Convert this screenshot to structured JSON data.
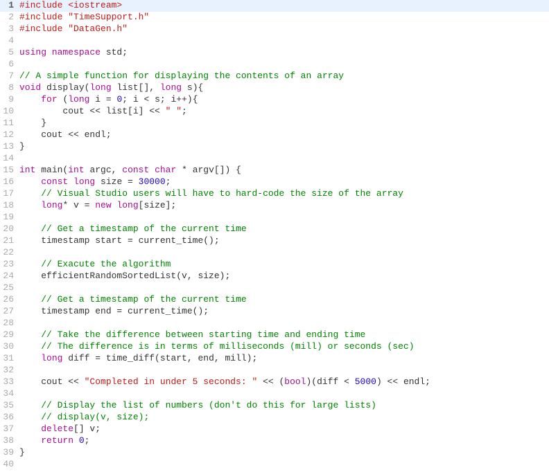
{
  "lines": [
    {
      "n": 1,
      "hl": true,
      "tokens": [
        {
          "t": "#include ",
          "c": "pp-kw"
        },
        {
          "t": "<iostream>",
          "c": "inc-sys"
        }
      ]
    },
    {
      "n": 2,
      "tokens": [
        {
          "t": "#include ",
          "c": "pp-kw"
        },
        {
          "t": "\"TimeSupport.h\"",
          "c": "str"
        }
      ]
    },
    {
      "n": 3,
      "tokens": [
        {
          "t": "#include ",
          "c": "pp-kw"
        },
        {
          "t": "\"DataGen.h\"",
          "c": "str"
        }
      ]
    },
    {
      "n": 4,
      "tokens": []
    },
    {
      "n": 5,
      "tokens": [
        {
          "t": "using namespace ",
          "c": "kw"
        },
        {
          "t": "std;",
          "c": "id"
        }
      ]
    },
    {
      "n": 6,
      "tokens": []
    },
    {
      "n": 7,
      "tokens": [
        {
          "t": "// A simple function for displaying the contents of an array",
          "c": "cmt"
        }
      ]
    },
    {
      "n": 8,
      "tokens": [
        {
          "t": "void ",
          "c": "kw"
        },
        {
          "t": "display(",
          "c": "id"
        },
        {
          "t": "long ",
          "c": "kw"
        },
        {
          "t": "list[], ",
          "c": "id"
        },
        {
          "t": "long ",
          "c": "kw"
        },
        {
          "t": "s){",
          "c": "id"
        }
      ]
    },
    {
      "n": 9,
      "tokens": [
        {
          "t": "    ",
          "c": "id"
        },
        {
          "t": "for ",
          "c": "kw"
        },
        {
          "t": "(",
          "c": "id"
        },
        {
          "t": "long ",
          "c": "kw"
        },
        {
          "t": "i = ",
          "c": "id"
        },
        {
          "t": "0",
          "c": "num"
        },
        {
          "t": "; i < s; i++){",
          "c": "id"
        }
      ]
    },
    {
      "n": 10,
      "tokens": [
        {
          "t": "        cout << list[i] << ",
          "c": "id"
        },
        {
          "t": "\" \"",
          "c": "str"
        },
        {
          "t": ";",
          "c": "id"
        }
      ]
    },
    {
      "n": 11,
      "tokens": [
        {
          "t": "    }",
          "c": "id"
        }
      ]
    },
    {
      "n": 12,
      "tokens": [
        {
          "t": "    cout << endl;",
          "c": "id"
        }
      ]
    },
    {
      "n": 13,
      "tokens": [
        {
          "t": "}",
          "c": "id"
        }
      ]
    },
    {
      "n": 14,
      "tokens": []
    },
    {
      "n": 15,
      "tokens": [
        {
          "t": "int ",
          "c": "kw"
        },
        {
          "t": "main(",
          "c": "id"
        },
        {
          "t": "int ",
          "c": "kw"
        },
        {
          "t": "argc, ",
          "c": "id"
        },
        {
          "t": "const char ",
          "c": "kw"
        },
        {
          "t": "* argv[]) {",
          "c": "id"
        }
      ]
    },
    {
      "n": 16,
      "tokens": [
        {
          "t": "    ",
          "c": "id"
        },
        {
          "t": "const long ",
          "c": "kw"
        },
        {
          "t": "size = ",
          "c": "id"
        },
        {
          "t": "30000",
          "c": "num"
        },
        {
          "t": ";",
          "c": "id"
        }
      ]
    },
    {
      "n": 17,
      "tokens": [
        {
          "t": "    ",
          "c": "id"
        },
        {
          "t": "// Visual Studio users will have to hard-code the size of the array",
          "c": "cmt"
        }
      ]
    },
    {
      "n": 18,
      "tokens": [
        {
          "t": "    ",
          "c": "id"
        },
        {
          "t": "long",
          "c": "kw"
        },
        {
          "t": "* v = ",
          "c": "id"
        },
        {
          "t": "new long",
          "c": "kw"
        },
        {
          "t": "[size];",
          "c": "id"
        }
      ]
    },
    {
      "n": 19,
      "tokens": []
    },
    {
      "n": 20,
      "tokens": [
        {
          "t": "    ",
          "c": "id"
        },
        {
          "t": "// Get a timestamp of the current time",
          "c": "cmt"
        }
      ]
    },
    {
      "n": 21,
      "tokens": [
        {
          "t": "    timestamp start = current_time();",
          "c": "id"
        }
      ]
    },
    {
      "n": 22,
      "tokens": []
    },
    {
      "n": 23,
      "tokens": [
        {
          "t": "    ",
          "c": "id"
        },
        {
          "t": "// Exacute the algorithm",
          "c": "cmt"
        }
      ]
    },
    {
      "n": 24,
      "tokens": [
        {
          "t": "    efficientRandomSortedList(v, size);",
          "c": "id"
        }
      ]
    },
    {
      "n": 25,
      "tokens": []
    },
    {
      "n": 26,
      "tokens": [
        {
          "t": "    ",
          "c": "id"
        },
        {
          "t": "// Get a timestamp of the current time",
          "c": "cmt"
        }
      ]
    },
    {
      "n": 27,
      "tokens": [
        {
          "t": "    timestamp end = current_time();",
          "c": "id"
        }
      ]
    },
    {
      "n": 28,
      "tokens": []
    },
    {
      "n": 29,
      "tokens": [
        {
          "t": "    ",
          "c": "id"
        },
        {
          "t": "// Take the difference between starting time and ending time",
          "c": "cmt"
        }
      ]
    },
    {
      "n": 30,
      "tokens": [
        {
          "t": "    ",
          "c": "id"
        },
        {
          "t": "// The difference is in terms of milliseconds (mill) or seconds (sec)",
          "c": "cmt"
        }
      ]
    },
    {
      "n": 31,
      "tokens": [
        {
          "t": "    ",
          "c": "id"
        },
        {
          "t": "long ",
          "c": "kw"
        },
        {
          "t": "diff = time_diff(start, end, mill);",
          "c": "id"
        }
      ]
    },
    {
      "n": 32,
      "tokens": []
    },
    {
      "n": 33,
      "tokens": [
        {
          "t": "    cout << ",
          "c": "id"
        },
        {
          "t": "\"Completed in under 5 seconds: \"",
          "c": "str"
        },
        {
          "t": " << (",
          "c": "id"
        },
        {
          "t": "bool",
          "c": "kw"
        },
        {
          "t": ")(diff < ",
          "c": "id"
        },
        {
          "t": "5000",
          "c": "num"
        },
        {
          "t": ") << endl;",
          "c": "id"
        }
      ]
    },
    {
      "n": 34,
      "tokens": []
    },
    {
      "n": 35,
      "tokens": [
        {
          "t": "    ",
          "c": "id"
        },
        {
          "t": "// Display the list of numbers (don't do this for large lists)",
          "c": "cmt"
        }
      ]
    },
    {
      "n": 36,
      "tokens": [
        {
          "t": "    ",
          "c": "id"
        },
        {
          "t": "// display(v, size);",
          "c": "cmt"
        }
      ]
    },
    {
      "n": 37,
      "tokens": [
        {
          "t": "    ",
          "c": "id"
        },
        {
          "t": "delete",
          "c": "kw"
        },
        {
          "t": "[] v;",
          "c": "id"
        }
      ]
    },
    {
      "n": 38,
      "tokens": [
        {
          "t": "    ",
          "c": "id"
        },
        {
          "t": "return ",
          "c": "kw"
        },
        {
          "t": "0",
          "c": "num"
        },
        {
          "t": ";",
          "c": "id"
        }
      ]
    },
    {
      "n": 39,
      "tokens": [
        {
          "t": "}",
          "c": "id"
        }
      ]
    },
    {
      "n": 40,
      "tokens": []
    }
  ]
}
